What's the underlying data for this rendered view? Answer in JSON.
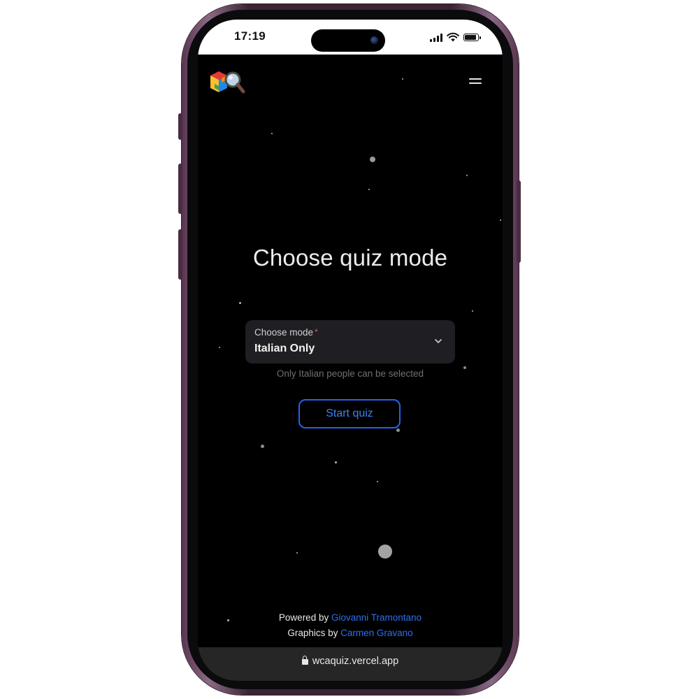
{
  "status_bar": {
    "time": "17:19",
    "icons": [
      "cellular-signal-icon",
      "wifi-icon",
      "battery-icon"
    ]
  },
  "header": {
    "logo_icon": "wca-cube-magnifier-logo",
    "menu_icon": "hamburger-menu-icon"
  },
  "main": {
    "title": "Choose quiz mode",
    "mode_select": {
      "label": "Choose mode",
      "required_mark": "*",
      "value": "Italian Only",
      "helper_text": "Only Italian people can be selected"
    },
    "start_button_label": "Start quiz"
  },
  "footer": {
    "powered_prefix": "Powered by",
    "powered_name": "Giovanni Tramontano",
    "graphics_prefix": "Graphics by",
    "graphics_name": "Carmen Gravano"
  },
  "browser": {
    "url": "wcaquiz.vercel.app"
  },
  "colors": {
    "background": "#000000",
    "accent_blue": "#2563eb",
    "link_blue": "#2f6fed",
    "required_red": "#e0556a",
    "select_bg": "#1f1f23",
    "phone_frame": "#3b2436"
  }
}
